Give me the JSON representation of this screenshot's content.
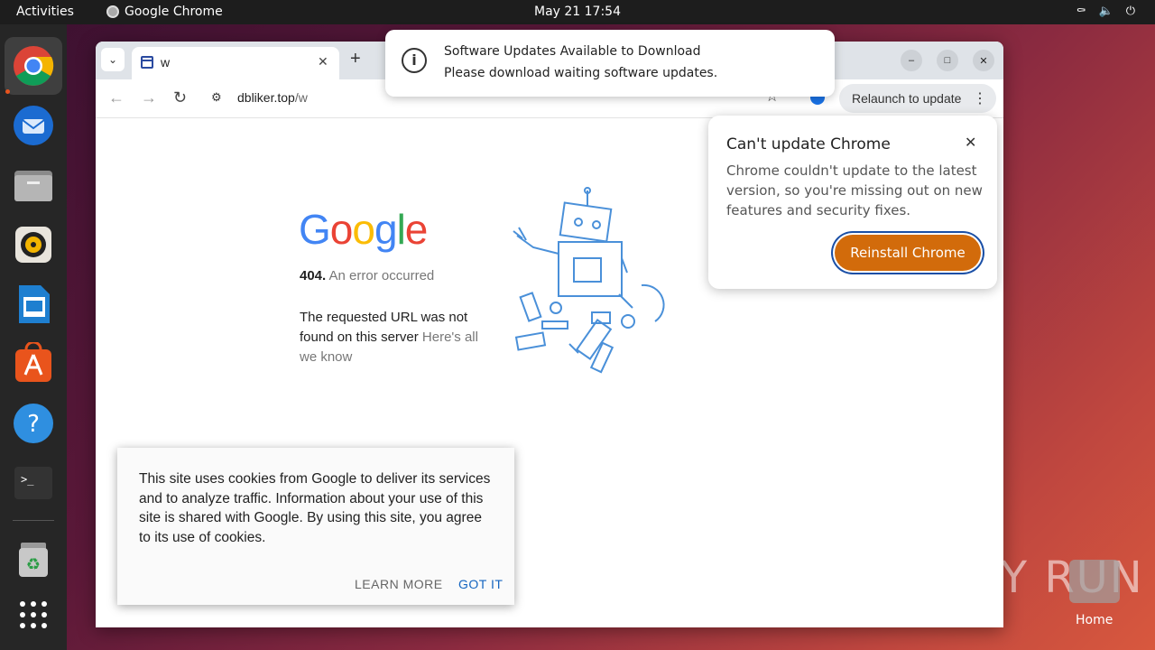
{
  "topbar": {
    "activities": "Activities",
    "app_name": "Google Chrome",
    "clock": "May 21  17:54"
  },
  "dock": {
    "items": [
      "chrome-icon",
      "thunderbird-icon",
      "files-icon",
      "rhythmbox-icon",
      "writer-icon",
      "app-center-icon",
      "help-icon",
      "terminal-icon",
      "trash-icon",
      "app-grid-icon"
    ]
  },
  "browser": {
    "tab_title": "w",
    "url_host": "dbliker.top",
    "url_path": "/w",
    "relaunch_label": "Relaunch to update"
  },
  "page": {
    "logo_letters": [
      "G",
      "o",
      "o",
      "g",
      "l",
      "e"
    ],
    "logo_colors": [
      "#4285F4",
      "#EA4335",
      "#FBBC05",
      "#4285F4",
      "#34A853",
      "#EA4335"
    ],
    "error_code": "404.",
    "error_title": "An error occurred",
    "error_line1": "The requested URL was not found on this server",
    "error_link": "Here's all we know"
  },
  "cookie": {
    "text": "This site uses cookies from Google to deliver its services and to analyze traffic. Information about your use of this site is shared with Google. By using this site, you agree to its use of cookies.",
    "learn_more": "LEARN MORE",
    "got_it": "GOT IT"
  },
  "notification": {
    "title": "Software Updates Available to Download",
    "body": "Please download waiting software updates."
  },
  "update_bubble": {
    "title": "Can't update Chrome",
    "body": "Chrome couldn't update to the latest version, so you're missing out on new features and security fixes.",
    "button": "Reinstall Chrome",
    "button_color": "#d26b0b"
  },
  "desktop": {
    "watermark": "ANY RUN",
    "home_label": "Home"
  }
}
